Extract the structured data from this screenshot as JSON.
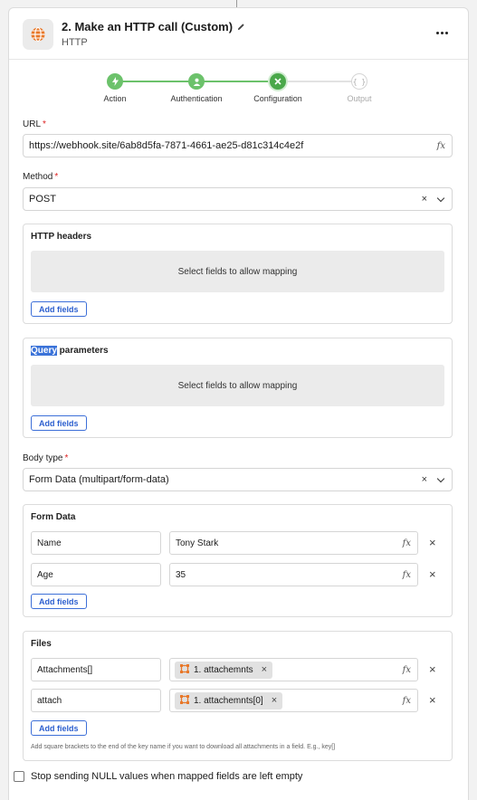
{
  "header": {
    "title": "2. Make an HTTP call (Custom)",
    "subtitle": "HTTP"
  },
  "steps": [
    {
      "label": "Action",
      "state": "done"
    },
    {
      "label": "Authentication",
      "state": "done"
    },
    {
      "label": "Configuration",
      "state": "active"
    },
    {
      "label": "Output",
      "state": "future"
    }
  ],
  "url": {
    "label": "URL",
    "required_mark": "*",
    "value": "https://webhook.site/6ab8d5fa-7871-4661-ae25-d81c314c4e2f"
  },
  "method": {
    "label": "Method",
    "required_mark": "*",
    "value": "POST"
  },
  "http_headers": {
    "title": "HTTP headers",
    "placeholder": "Select fields to allow mapping",
    "add_label": "Add fields"
  },
  "query_parameters": {
    "title_highlight": "Query",
    "title_rest": " parameters",
    "placeholder": "Select fields to allow mapping",
    "add_label": "Add fields"
  },
  "body_type": {
    "label": "Body type",
    "required_mark": "*",
    "value": "Form Data (multipart/form-data)"
  },
  "form_data": {
    "title": "Form Data",
    "rows": [
      {
        "key": "Name",
        "value": "Tony Stark"
      },
      {
        "key": "Age",
        "value": "35"
      }
    ],
    "add_label": "Add fields"
  },
  "files": {
    "title": "Files",
    "rows": [
      {
        "key": "Attachments[]",
        "chip": "1. attachemnts"
      },
      {
        "key": "attach",
        "chip": "1. attachemnts[0]"
      }
    ],
    "add_label": "Add fields",
    "hint": "Add square brackets to the end of the key name if you want to download all attachments in a field. E.g., key[]"
  },
  "null_option": {
    "label": "Stop sending NULL values when mapped fields are left empty"
  },
  "colors": {
    "step_done": "#6cc26b",
    "step_active": "#4aa84a",
    "step_line": "#6cc26b",
    "accent_blue": "#2c5fcf",
    "required": "#dd2222",
    "app_icon": "#e8782a"
  },
  "icons": {
    "fx": "fx",
    "clear": "×",
    "remove": "×"
  }
}
